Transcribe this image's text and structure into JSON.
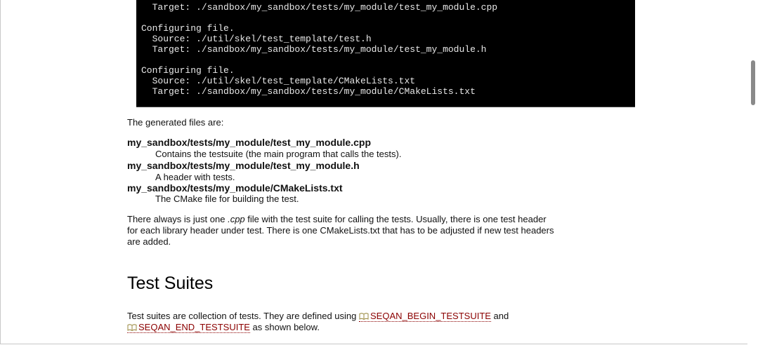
{
  "code_block": {
    "lines": [
      "  Target: ./sandbox/my_sandbox/tests/my_module/test_my_module.cpp",
      "",
      "Configuring file.",
      "  Source: ./util/skel/test_template/test.h",
      "  Target: ./sandbox/my_sandbox/tests/my_module/test_my_module.h",
      "",
      "Configuring file.",
      "  Source: ./util/skel/test_template/CMakeLists.txt",
      "  Target: ./sandbox/my_sandbox/tests/my_module/CMakeLists.txt"
    ]
  },
  "intro_text": "The generated files are:",
  "file_list": [
    {
      "term": "my_sandbox/tests/my_module/test_my_module.cpp",
      "description": "Contains the testsuite (the main program that calls the tests)."
    },
    {
      "term": "my_sandbox/tests/my_module/test_my_module.h",
      "description": "A header with tests."
    },
    {
      "term": "my_sandbox/tests/my_module/CMakeLists.txt",
      "description": "The CMake file for building the test."
    }
  ],
  "paragraph": {
    "part1": "There always is just one ",
    "emphasis": ".cpp",
    "part2": " file with the test suite for calling the tests. Usually, there is one test header",
    "line2": "for each library header under test. There is one CMakeLists.txt that has to be adjusted if new test headers",
    "line3": "are added."
  },
  "section_heading": "Test Suites",
  "section_paragraph": {
    "part1": "Test suites are collection of tests. They are defined using ",
    "link1": "SEQAN_BEGIN_TESTSUITE",
    "part2": " and",
    "link2": "SEQAN_END_TESTSUITE",
    "part3": " as shown below."
  },
  "colors": {
    "code_background": "#000000",
    "code_text": "#e8e8e8",
    "link": "#8b0000",
    "scrollbar_thumb": "#8a8a8a"
  },
  "icons": {
    "reference_link_icon": "book-icon"
  }
}
